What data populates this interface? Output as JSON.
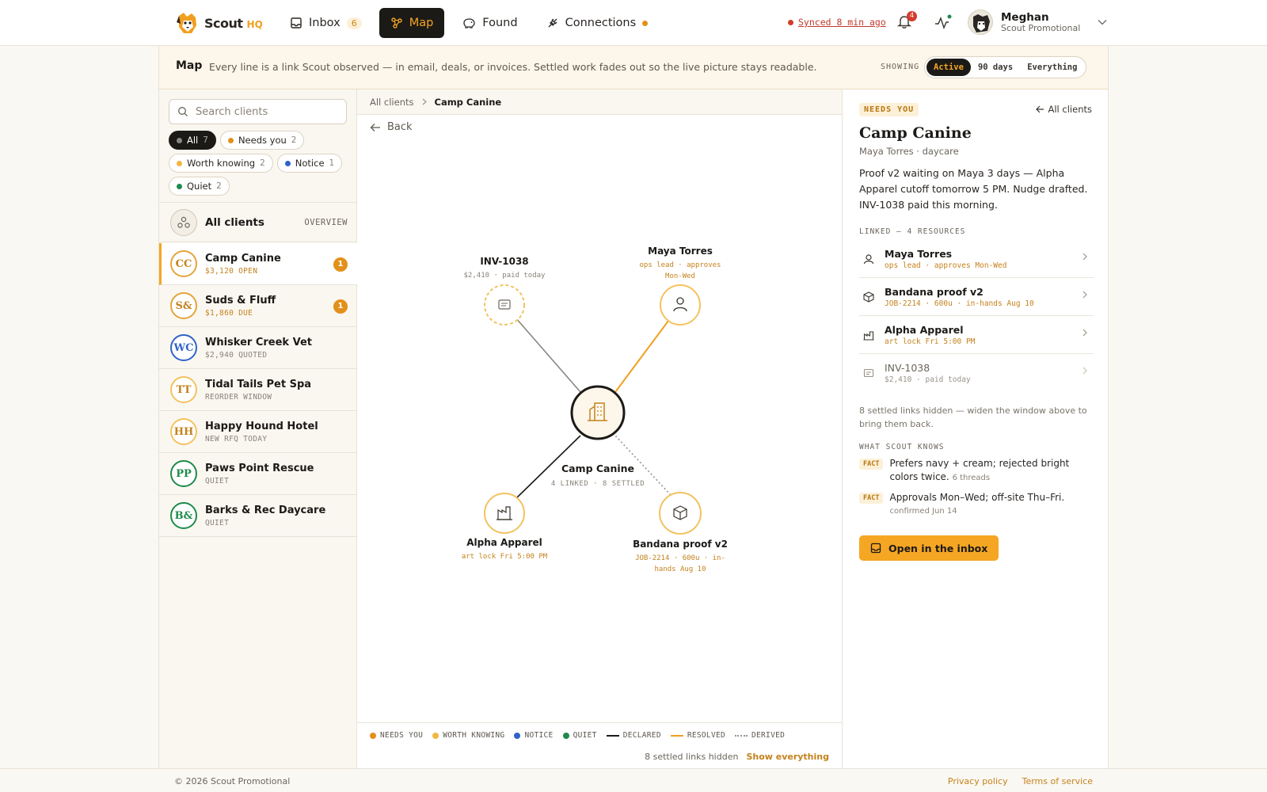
{
  "brand": {
    "name": "Scout",
    "suffix": "HQ"
  },
  "nav": {
    "inbox": {
      "label": "Inbox",
      "count": "6"
    },
    "map": {
      "label": "Map"
    },
    "found": {
      "label": "Found"
    },
    "connections": {
      "label": "Connections"
    }
  },
  "sync": {
    "label": "Synced 8 min ago"
  },
  "notifications": {
    "count": "4"
  },
  "user": {
    "name": "Meghan",
    "org": "Scout Promotional"
  },
  "map_header": {
    "title": "Map",
    "description": "Every line is a link Scout observed — in email, deals, or invoices. Settled work fades out so the live picture stays readable.",
    "showing_label": "SHOWING",
    "options": [
      "Active",
      "90 days",
      "Everything"
    ],
    "selected": "Active"
  },
  "sidebar": {
    "search_placeholder": "Search clients",
    "filters": [
      {
        "label": "All",
        "count": "7",
        "color": "#888888"
      },
      {
        "label": "Needs you",
        "count": "2",
        "color": "#e3901a"
      },
      {
        "label": "Worth knowing",
        "count": "2",
        "color": "#f2b740"
      },
      {
        "label": "Notice",
        "count": "1",
        "color": "#2f63c9"
      },
      {
        "label": "Quiet",
        "count": "2",
        "color": "#1f8a4c"
      }
    ],
    "all_clients": {
      "label": "All clients",
      "tag": "OVERVIEW"
    },
    "clients": [
      {
        "initials": "CC",
        "name": "Camp Canine",
        "sub": "$3,120 OPEN",
        "badge": "1",
        "color": "#e3a53a",
        "text_color": "#c4821c",
        "sub_color": "#c4821c"
      },
      {
        "initials": "S&",
        "name": "Suds & Fluff",
        "sub": "$1,860 DUE",
        "badge": "1",
        "color": "#e3a53a",
        "text_color": "#c4821c",
        "sub_color": "#c4821c"
      },
      {
        "initials": "WC",
        "name": "Whisker Creek Vet",
        "sub": "$2,940 QUOTED",
        "badge": "",
        "color": "#2f63c9",
        "text_color": "#2f63c9",
        "sub_color": "#8a8378"
      },
      {
        "initials": "TT",
        "name": "Tidal Tails Pet Spa",
        "sub": "REORDER WINDOW",
        "badge": "",
        "color": "#f2c35f",
        "text_color": "#c4821c",
        "sub_color": "#8a8378"
      },
      {
        "initials": "HH",
        "name": "Happy Hound Hotel",
        "sub": "NEW RFQ TODAY",
        "badge": "",
        "color": "#f2c35f",
        "text_color": "#c4821c",
        "sub_color": "#8a8378"
      },
      {
        "initials": "PP",
        "name": "Paws Point Rescue",
        "sub": "QUIET",
        "badge": "",
        "color": "#1f8a4c",
        "text_color": "#1f8a4c",
        "sub_color": "#8a8378"
      },
      {
        "initials": "B&",
        "name": "Barks & Rec Daycare",
        "sub": "QUIET",
        "badge": "",
        "color": "#1f8a4c",
        "text_color": "#1f8a4c",
        "sub_color": "#8a8378"
      }
    ]
  },
  "center": {
    "breadcrumb_root": "All clients",
    "breadcrumb_current": "Camp Canine",
    "back_label": "Back",
    "graph": {
      "center": {
        "name": "Camp Canine",
        "meta": "4 LINKED · 8 SETTLED"
      },
      "nodes": [
        {
          "name": "INV-1038",
          "meta1": "$2,410 · paid today",
          "meta2": "",
          "icon": "invoice-icon"
        },
        {
          "name": "Maya Torres",
          "meta1": "ops lead · approves",
          "meta2": "Mon-Wed",
          "icon": "person-icon"
        },
        {
          "name": "Alpha Apparel",
          "meta1": "art lock Fri 5:00 PM",
          "meta2": "",
          "icon": "factory-icon"
        },
        {
          "name": "Bandana proof v2",
          "meta1": "JOB-2214 · 600u · in-",
          "meta2": "hands Aug 10",
          "icon": "box-icon"
        }
      ]
    },
    "legend": {
      "needs_you": "NEEDS YOU",
      "worth_knowing": "WORTH KNOWING",
      "notice": "NOTICE",
      "quiet": "QUIET",
      "declared": "DECLARED",
      "resolved": "RESOLVED",
      "derived": "DERIVED"
    },
    "hidden_note": "8 settled links hidden",
    "show_everything": "Show everything"
  },
  "detail": {
    "tag": "NEEDS YOU",
    "all_clients_link": "All clients",
    "title": "Camp Canine",
    "subtitle": "Maya Torres · daycare",
    "summary": "Proof v2 waiting on Maya 3 days — Alpha Apparel cutoff tomorrow 5 PM. Nudge drafted. INV-1038 paid this morning.",
    "linked_label": "LINKED — 4 RESOURCES",
    "resources": [
      {
        "name": "Maya Torres",
        "meta": "ops lead · approves Mon-Wed"
      },
      {
        "name": "Bandana proof v2",
        "meta": "JOB-2214 · 600u · in-hands Aug 10"
      },
      {
        "name": "Alpha Apparel",
        "meta": "art lock Fri 5:00 PM"
      },
      {
        "name": "INV-1038",
        "meta": "$2,410 · paid today"
      }
    ],
    "hidden_note": "8 settled links hidden — widen the window above to bring them back.",
    "knows_label": "WHAT SCOUT KNOWS",
    "facts": [
      {
        "tag": "FACT",
        "text": "Prefers navy + cream; rejected bright colors twice.",
        "meta": "6 threads"
      },
      {
        "tag": "FACT",
        "text": "Approvals Mon–Wed; off-site Thu–Fri.",
        "meta": "confirmed Jun 14"
      }
    ],
    "open_button": "Open in the inbox"
  },
  "footer": {
    "copyright": "© 2026 Scout Promotional",
    "privacy": "Privacy policy",
    "terms": "Terms of service"
  },
  "colors": {
    "accent": "#f5a623",
    "needs_you": "#e3901a",
    "worth_knowing": "#f2b740",
    "notice": "#2f63c9",
    "quiet": "#1f8a4c",
    "alert": "#d33c2c"
  }
}
